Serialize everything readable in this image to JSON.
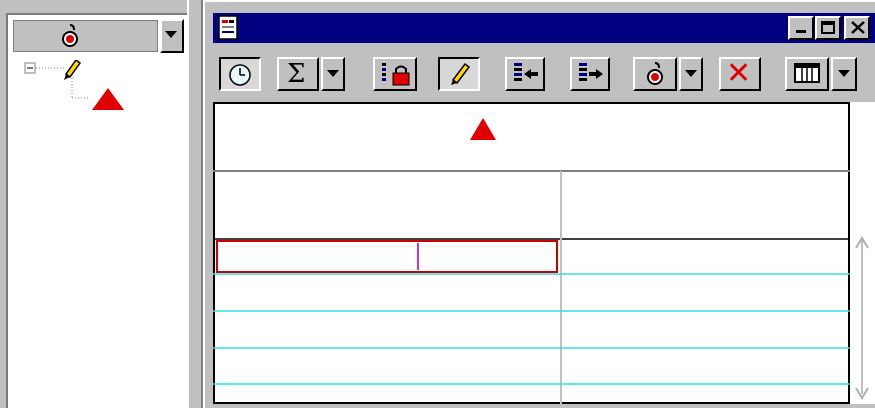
{
  "left_panel": {
    "combo_icon": "bomb-icon",
    "dropdown_icon": "chevron-down-icon",
    "tree": {
      "expander": "⊟",
      "root_icon": "pencil-icon",
      "child_icon": "red-triangle-icon"
    }
  },
  "window": {
    "title": "",
    "app_icon": "document-icon",
    "controls": [
      "minimize-icon",
      "maximize-icon",
      "close-icon"
    ]
  },
  "toolbar": {
    "buttons": [
      {
        "icon": "clock-icon",
        "pressed": true
      },
      {
        "icon": "sigma-icon",
        "label": "Σ",
        "pressed": false
      },
      {
        "icon": "chevron-down-icon",
        "pressed": false
      },
      {
        "icon": "lock-icon",
        "pressed": false
      },
      {
        "icon": "pencil-icon",
        "pressed": true
      },
      {
        "icon": "insert-before-icon",
        "pressed": false
      },
      {
        "icon": "insert-after-icon",
        "pressed": false
      },
      {
        "icon": "bomb-icon",
        "pressed": false
      },
      {
        "icon": "chevron-down-icon",
        "pressed": false
      },
      {
        "icon": "delete-icon",
        "label": "✕",
        "pressed": false
      },
      {
        "icon": "columns-icon",
        "pressed": false
      },
      {
        "icon": "chevron-down-icon",
        "pressed": false
      }
    ]
  },
  "grid": {
    "header_icon": "red-triangle-icon",
    "rows_visible": 5,
    "accent_line_color": "#33e0e0",
    "selection_color": "#cc0000",
    "cursor_color": "#cc33cc"
  },
  "colors": {
    "face": "#c0c0c0",
    "titlebar": "#000080",
    "marker": "#e00000"
  }
}
